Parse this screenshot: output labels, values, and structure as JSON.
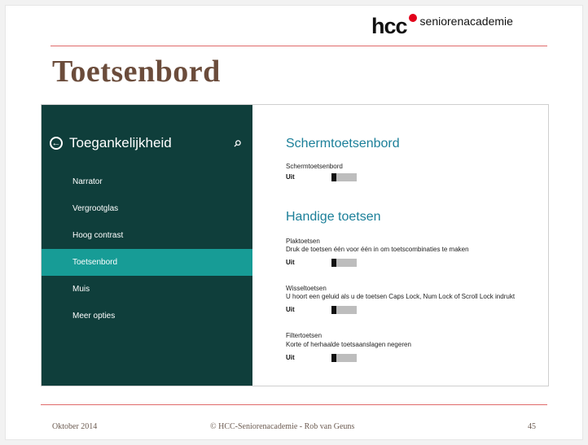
{
  "logo": {
    "hcc": "hcc",
    "academy": "seniorenacademie"
  },
  "slide": {
    "title": "Toetsenbord"
  },
  "sidebar": {
    "title": "Toegankelijkheid",
    "items": [
      {
        "label": "Narrator",
        "active": false
      },
      {
        "label": "Vergrootglas",
        "active": false
      },
      {
        "label": "Hoog contrast",
        "active": false
      },
      {
        "label": "Toetsenbord",
        "active": true
      },
      {
        "label": "Muis",
        "active": false
      },
      {
        "label": "Meer opties",
        "active": false
      }
    ]
  },
  "settings": {
    "section1": "Schermtoetsenbord",
    "screen_keyboard": {
      "label": "Schermtoetsenbord",
      "value": "Uit"
    },
    "section2": "Handige toetsen",
    "sticky": {
      "label": "Plaktoetsen",
      "desc": "Druk de toetsen één voor één in om toetscombinaties te maken",
      "value": "Uit"
    },
    "toggle_keys": {
      "label": "Wisseltoetsen",
      "desc": "U hoort een geluid als u de toetsen Caps Lock, Num Lock of Scroll Lock indrukt",
      "value": "Uit"
    },
    "filter": {
      "label": "Filtertoetsen",
      "desc": "Korte of herhaalde toetsaanslagen negeren",
      "value": "Uit"
    }
  },
  "footer": {
    "date": "Oktober 2014",
    "credit": "© HCC-Seniorenacademie - Rob van Geuns",
    "page": "45"
  },
  "colors": {
    "sidebar": "#0f3e3b",
    "active": "#179c96",
    "heading": "#1b7f99",
    "title": "#6b4c3b",
    "rule": "#e06a6a"
  }
}
